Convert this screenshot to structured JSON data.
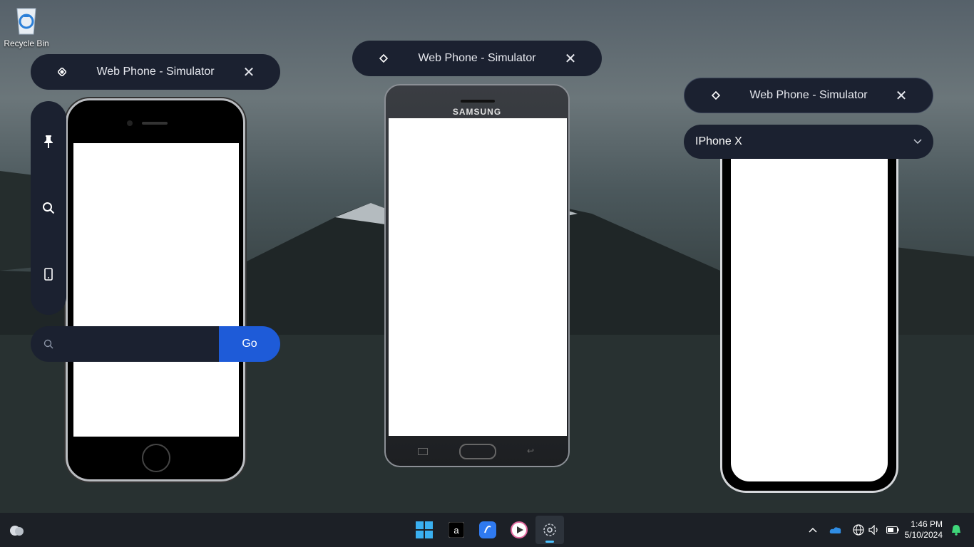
{
  "desktop": {
    "recycle_bin_label": "Recycle Bin"
  },
  "windows": [
    {
      "title": "Web Phone - Simulator"
    },
    {
      "title": "Web Phone - Simulator"
    },
    {
      "title": "Web Phone - Simulator"
    }
  ],
  "sidebar": {
    "tools": [
      "pin-icon",
      "search-icon",
      "device-icon"
    ]
  },
  "search": {
    "placeholder": "",
    "value": "",
    "go_label": "Go"
  },
  "device_select": {
    "selected": "IPhone X"
  },
  "phones": {
    "samsung_brand": "SAMSUNG"
  },
  "taskbar": {
    "apps": [
      "weather-icon",
      "start-icon",
      "ai-app-icon",
      "link-app-icon",
      "media-player-icon",
      "simulator-app-icon"
    ],
    "time": "1:46 PM",
    "date": "5/10/2024"
  },
  "colors": {
    "panel": "#1b2130",
    "accent": "#1e5bd8"
  }
}
